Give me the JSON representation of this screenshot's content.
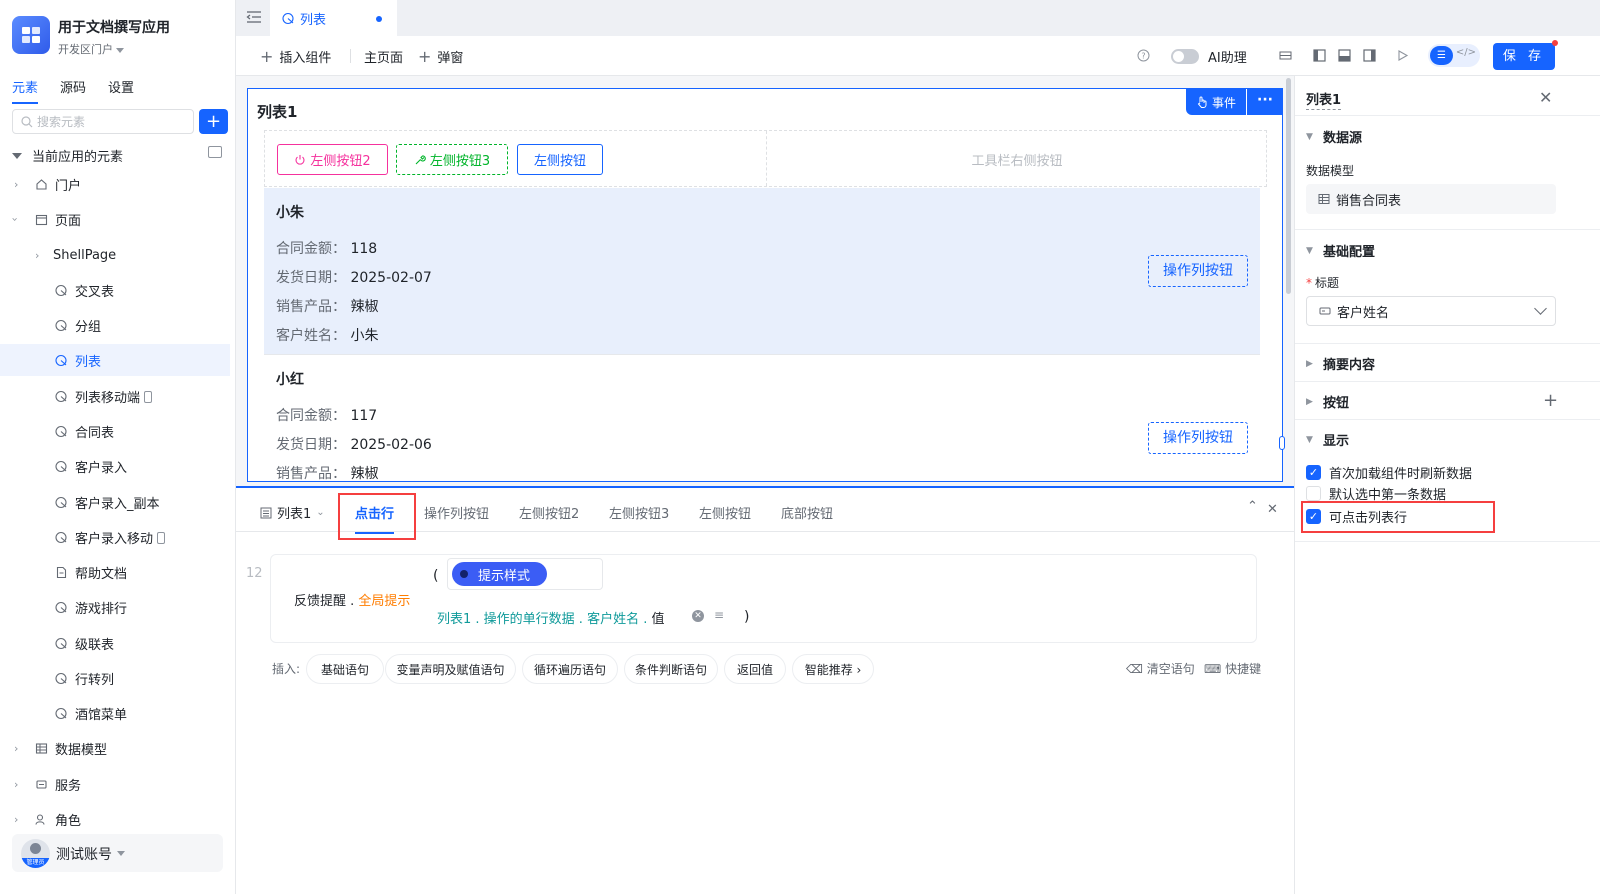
{
  "app": {
    "title": "用于文档撰写应用",
    "subtitle": "开发区门户"
  },
  "sidebar": {
    "tabs": [
      "元素",
      "源码",
      "设置"
    ],
    "active_tab": 0,
    "search_placeholder": "搜索元素",
    "add_label": "+",
    "tree_root": "当前应用的元素",
    "items": [
      {
        "label": "门户",
        "icon": "home-icon"
      },
      {
        "label": "页面",
        "icon": "pages-icon"
      },
      {
        "label": "ShellPage",
        "icon": ""
      },
      {
        "label": "交叉表",
        "icon": "page-icon"
      },
      {
        "label": "分组",
        "icon": "page-icon"
      },
      {
        "label": "列表",
        "icon": "page-icon"
      },
      {
        "label": "列表移动端",
        "icon": "page-icon"
      },
      {
        "label": "合同表",
        "icon": "page-icon"
      },
      {
        "label": "客户录入",
        "icon": "page-icon"
      },
      {
        "label": "客户录入_副本",
        "icon": "page-icon"
      },
      {
        "label": "客户录入移动",
        "icon": "page-icon"
      },
      {
        "label": "帮助文档",
        "icon": "doc-icon"
      },
      {
        "label": "游戏排行",
        "icon": "page-icon"
      },
      {
        "label": "级联表",
        "icon": "page-icon"
      },
      {
        "label": "行转列",
        "icon": "page-icon"
      },
      {
        "label": "酒馆菜单",
        "icon": "page-icon"
      },
      {
        "label": "数据模型",
        "icon": "table-icon"
      },
      {
        "label": "服务",
        "icon": "service-icon"
      },
      {
        "label": "角色",
        "icon": "role-icon"
      }
    ],
    "account": {
      "name": "测试账号",
      "badge": "管理员"
    }
  },
  "tabbar": {
    "tab_label": "列表"
  },
  "toolbar": {
    "insert": "插入组件",
    "home": "主页面",
    "popup": "弹窗",
    "ai": "AI助理",
    "save": "保 存"
  },
  "list": {
    "title": "列表1",
    "event_btn": "事件",
    "more": "···",
    "left_buttons": [
      "左侧按钮2",
      "左侧按钮3",
      "左侧按钮"
    ],
    "right_placeholder": "工具栏右侧按钮",
    "op_button": "操作列按钮",
    "rows": [
      {
        "name": "小朱",
        "fields": [
          {
            "k": "合同金额：",
            "v": "118"
          },
          {
            "k": "发货日期：",
            "v": "2025-02-07"
          },
          {
            "k": "销售产品：",
            "v": "辣椒"
          },
          {
            "k": "客户姓名：",
            "v": "小朱"
          }
        ]
      },
      {
        "name": "小红",
        "fields": [
          {
            "k": "合同金额：",
            "v": "117"
          },
          {
            "k": "发货日期：",
            "v": "2025-02-06"
          },
          {
            "k": "销售产品：",
            "v": "辣椒"
          }
        ]
      }
    ]
  },
  "editor": {
    "component": "列表1",
    "tabs": [
      "点击行",
      "操作列按钮",
      "左侧按钮2",
      "左侧按钮3",
      "左侧按钮",
      "底部按钮"
    ],
    "active_tab": 0,
    "line_no": "12",
    "call_object": "反馈提醒 . ",
    "call_method": "全局提示",
    "open_paren": "(",
    "close_paren": ")",
    "hint_chip": "提示样式",
    "arg_path": "列表1 . 操作的单行数据 . 客户姓名 . ",
    "arg_tail": "值",
    "insert_label": "插入:",
    "insert_chips": [
      "基础语句",
      "变量声明及赋值语句",
      "循环遍历语句",
      "条件判断语句",
      "返回值",
      "智能推荐 ›"
    ],
    "clear_label": "清空语句",
    "shortcut_label": "快捷键"
  },
  "panel": {
    "title": "列表1",
    "sections": {
      "datasource": "数据源",
      "basic": "基础配置",
      "summary": "摘要内容",
      "buttons": "按钮",
      "display": "显示"
    },
    "model_label": "数据模型",
    "model_value": "销售合同表",
    "title_label": "标题",
    "title_required": "*",
    "title_value": "客户姓名",
    "checkboxes": [
      {
        "label": "首次加载组件时刷新数据",
        "checked": true
      },
      {
        "label": "默认选中第一条数据",
        "checked": false
      },
      {
        "label": "可点击列表行",
        "checked": true
      }
    ]
  },
  "colors": {
    "primary": "#1664ff",
    "highlight_box": "#f53f3f",
    "row_selected": "#e8effc",
    "pink_button": "#f5319d",
    "green_button": "#00b42a",
    "method": "#ff7d00",
    "arg_teal": "#0f9a9a"
  }
}
